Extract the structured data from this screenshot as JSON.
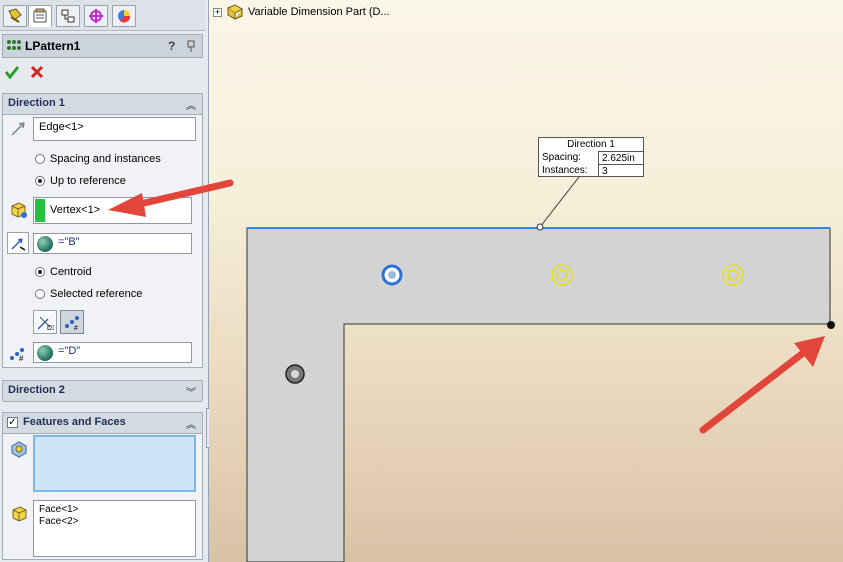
{
  "tabs": [
    {
      "icon": "feature-manager-icon"
    },
    {
      "icon": "property-manager-icon"
    },
    {
      "icon": "configuration-manager-icon"
    },
    {
      "icon": "dimxpert-manager-icon"
    },
    {
      "icon": "display-manager-icon"
    }
  ],
  "feature": {
    "title": "LPattern1",
    "help_label": "?"
  },
  "direction1": {
    "header": "Direction 1",
    "edge_value": "Edge<1>",
    "spacing_option": "Spacing and instances",
    "up_to_reference_option": "Up to reference",
    "reference_value": "Vertex<1>",
    "offset_value": "=\"B\"",
    "centroid_option": "Centroid",
    "selected_reference_option": "Selected reference",
    "instances_value": "=\"D\""
  },
  "direction2": {
    "header": "Direction 2"
  },
  "features_and_faces": {
    "header": "Features and Faces",
    "faces": [
      "Face<1>",
      "Face<2>"
    ]
  },
  "tree": {
    "part_name": "Variable Dimension Part  (D..."
  },
  "callout": {
    "title": "Direction 1",
    "spacing_label": "Spacing:",
    "spacing_value": "2.625in",
    "instances_label": "Instances:",
    "instances_value": "3"
  },
  "colors": {
    "arrow": "#e2463b",
    "selection_green": "#22c23c",
    "edge_blue": "#2f88e8",
    "hole_preview_yellow": "#e5e117",
    "part_gray": "#d3d3d3"
  }
}
